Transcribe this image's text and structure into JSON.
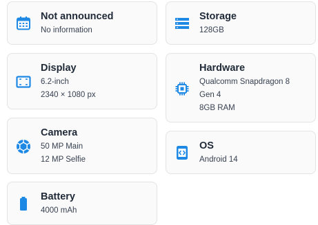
{
  "accent_color": "#1e88e5",
  "cards": {
    "release": {
      "icon": "calendar-icon",
      "title": "Not announced",
      "lines": [
        "No information"
      ]
    },
    "storage": {
      "icon": "storage-icon",
      "title": "Storage",
      "lines": [
        "128GB"
      ]
    },
    "display": {
      "icon": "display-icon",
      "title": "Display",
      "lines": [
        "6.2-inch",
        "2340 × 1080 px"
      ]
    },
    "hardware": {
      "icon": "chip-icon",
      "title": "Hardware",
      "lines": [
        "Qualcomm Snapdragon 8",
        "Gen 4",
        "8GB RAM"
      ]
    },
    "camera": {
      "icon": "camera-aperture-icon",
      "title": "Camera",
      "lines": [
        "50 MP Main",
        "12 MP Selfie"
      ]
    },
    "os": {
      "icon": "os-icon",
      "title": "OS",
      "lines": [
        "Android 14"
      ]
    },
    "battery": {
      "icon": "battery-icon",
      "title": "Battery",
      "lines": [
        "4000 mAh"
      ]
    }
  }
}
